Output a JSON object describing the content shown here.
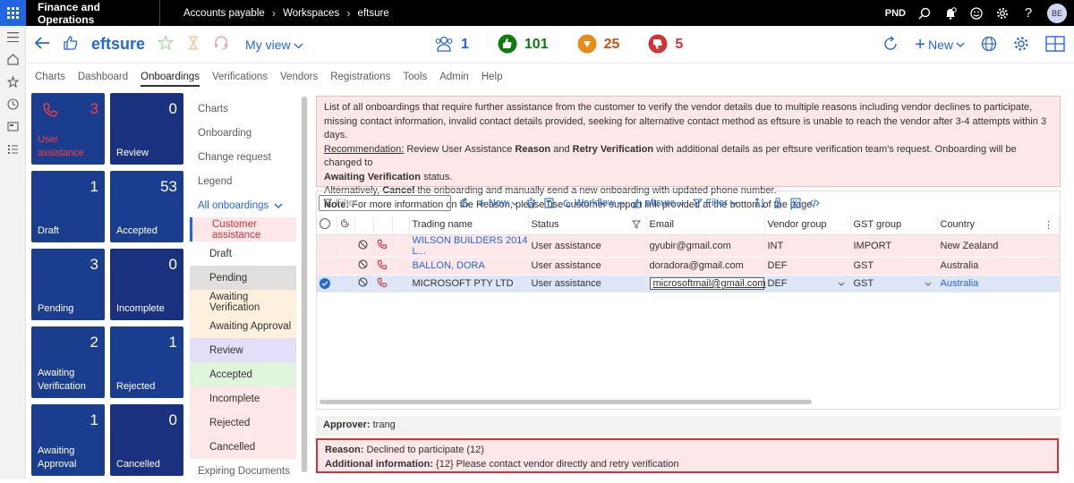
{
  "topbar": {
    "app_title": "Finance and Operations",
    "breadcrumb": [
      "Accounts payable",
      "Workspaces",
      "eftsure"
    ],
    "legal_entity": "PND",
    "avatar_initials": "BE"
  },
  "actionbar": {
    "workspace_title": "eftsure",
    "view_label": "My view",
    "kpis": [
      {
        "icon": "users-icon",
        "value": "1",
        "color": "#2266e3"
      },
      {
        "icon": "thumbs-up-icon",
        "value": "101",
        "color": "#107c10"
      },
      {
        "icon": "pending-icon",
        "value": "25",
        "color": "#ca5010"
      },
      {
        "icon": "thumbs-down-icon",
        "value": "5",
        "color": "#d13438"
      }
    ],
    "new_label": "New"
  },
  "tabs": [
    "Charts",
    "Dashboard",
    "Onboardings",
    "Verifications",
    "Vendors",
    "Registrations",
    "Tools",
    "Admin",
    "Help"
  ],
  "tiles": [
    {
      "count": "3",
      "label": "User assistance"
    },
    {
      "count": "0",
      "label": "Review"
    },
    {
      "count": "1",
      "label": "Draft"
    },
    {
      "count": "53",
      "label": "Accepted"
    },
    {
      "count": "3",
      "label": "Pending"
    },
    {
      "count": "0",
      "label": "Incomplete"
    },
    {
      "count": "2",
      "label": "Awaiting Verification"
    },
    {
      "count": "1",
      "label": "Rejected"
    },
    {
      "count": "1",
      "label": "Awaiting Approval"
    },
    {
      "count": "0",
      "label": "Cancelled"
    }
  ],
  "sublist": {
    "top": [
      "Charts",
      "Onboarding",
      "Change request",
      "Legend"
    ],
    "group_label": "All onboardings",
    "statuses": [
      {
        "label": "Customer assistance",
        "bg": "#fde7e9",
        "color": "#d13438"
      },
      {
        "label": "Draft",
        "bg": "#ffffff",
        "color": "#323130"
      },
      {
        "label": "Pending",
        "bg": "#e1dfdd",
        "color": "#323130"
      },
      {
        "label": "Awaiting Verification",
        "bg": "#fdf0dc",
        "color": "#323130"
      },
      {
        "label": "Awaiting Approval",
        "bg": "#fdf0dc",
        "color": "#323130"
      },
      {
        "label": "Review",
        "bg": "#e2e0f8",
        "color": "#323130"
      },
      {
        "label": "Accepted",
        "bg": "#dff6dd",
        "color": "#323130"
      },
      {
        "label": "Incomplete",
        "bg": "#fde7e9",
        "color": "#323130"
      },
      {
        "label": "Rejected",
        "bg": "#fde7e9",
        "color": "#323130"
      },
      {
        "label": "Cancelled",
        "bg": "#fde7e9",
        "color": "#323130"
      }
    ],
    "bottom": "Expiring Documents"
  },
  "banner": {
    "line1": "List of all onboardings that require further assistance from the customer to verify the vendor details due to multiple reasons including vendor declines to participate, missing contact information, invalid contact details provided, seeking for alternative contact method as eftsure is unable to reach the vendor after 3-4 attempts within 3 days.",
    "rec_label": "Recommendation:",
    "rec_a": "Review User Assistance",
    "rec_b": "Reason",
    "rec_c": "and",
    "rec_d": "Retry Verification",
    "rec_e": "with additional details as per eftsure verification team's request. Onboarding will be changed to",
    "rec_f": "Awaiting Verification",
    "rec_g": "status.",
    "alt_a": "Alternatively,",
    "alt_b": "Cancel",
    "alt_c": "the onboarding and manually send a new onboarding with updated phone number.",
    "note_label": "Note:",
    "note": "For more information on the Reason, please use customer support link provided at the bottom of the page."
  },
  "grid_toolbar": {
    "filter_placeholder": "Filter",
    "new": "New",
    "workflow": "Workflow",
    "eftsure": "eftsure",
    "filter": "Filter"
  },
  "grid": {
    "columns": [
      "Trading name",
      "Status",
      "Email",
      "Vendor group",
      "GST group",
      "Country"
    ],
    "rows": [
      [
        "WILSON BUILDERS 2014 L...",
        "User assistance",
        "gyubir@gmail.com",
        "INT",
        "IMPORT",
        "New Zealand"
      ],
      [
        "BALLON, DORA",
        "User assistance",
        "doradora@gmail.com",
        "DEF",
        "GST",
        "Australia"
      ],
      [
        "MICROSOFT PTY LTD",
        "User assistance",
        "microsoftmail@gmail.com",
        "DEF",
        "GST",
        "Australia"
      ]
    ]
  },
  "approver": {
    "label": "Approver:",
    "value": "trang"
  },
  "reason": {
    "label": "Reason:",
    "value": "Declined to participate (12)",
    "info_label": "Additional information:",
    "info_value": "{12} Please contact vendor directly and retry verification"
  }
}
